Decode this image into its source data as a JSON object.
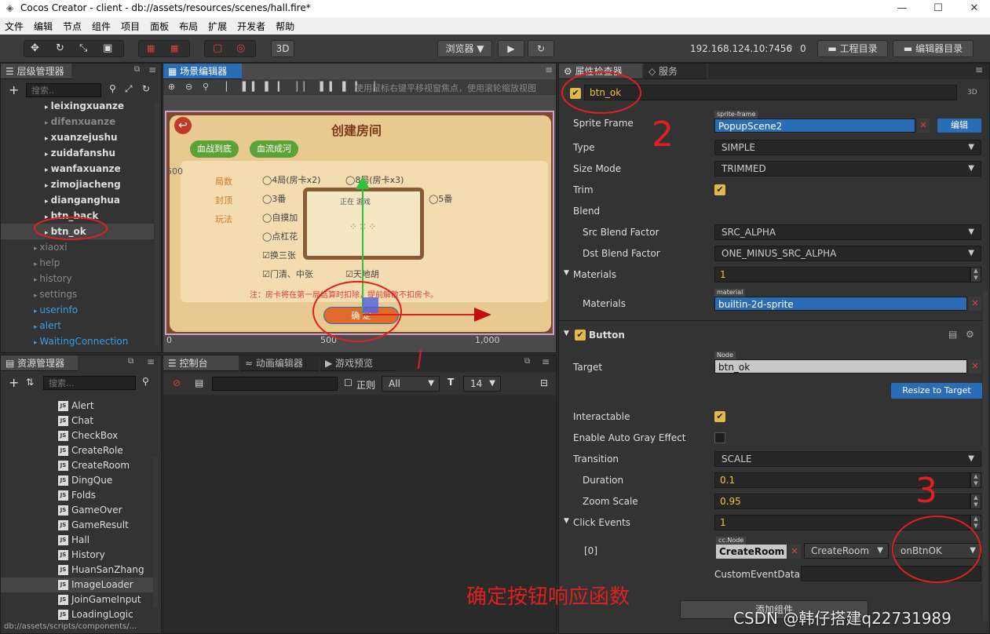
{
  "title": "Cocos Creator - client - db://assets/resources/scenes/hall.fire*",
  "window_controls": {
    "min": "—",
    "max": "☐",
    "close": "✕"
  },
  "menu": [
    "文件",
    "编辑",
    "节点",
    "组件",
    "项目",
    "面板",
    "布局",
    "扩展",
    "开发者",
    "帮助"
  ],
  "toolbar": {
    "mode_3d": "3D",
    "browser": "浏览器 ▼",
    "ip": "192.168.124.10:7456",
    "conn": "0",
    "project_dir": "工程目录",
    "editor_dir": "编辑器目录"
  },
  "hierarchy": {
    "tab": "层级管理器",
    "search_placeholder": "搜索..",
    "items": [
      {
        "label": "leixingxuanze",
        "style": "bold",
        "indent": 56
      },
      {
        "label": "difenxuanze",
        "style": "dimb",
        "indent": 56
      },
      {
        "label": "xuanzejushu",
        "style": "bold",
        "indent": 56
      },
      {
        "label": "zuidafanshu",
        "style": "bold",
        "indent": 56
      },
      {
        "label": "wanfaxuanze",
        "style": "bold",
        "indent": 56
      },
      {
        "label": "zimojiacheng",
        "style": "bold",
        "indent": 56
      },
      {
        "label": "dianganghua",
        "style": "bold",
        "indent": 56
      },
      {
        "label": "btn_back",
        "style": "bold",
        "indent": 56
      },
      {
        "label": "btn_ok",
        "style": "bold sel",
        "indent": 56
      },
      {
        "label": "xiaoxi",
        "style": "dim",
        "indent": 42
      },
      {
        "label": "help",
        "style": "dim",
        "indent": 42
      },
      {
        "label": "history",
        "style": "dim",
        "indent": 42
      },
      {
        "label": "settings",
        "style": "dim",
        "indent": 42
      },
      {
        "label": "userinfo",
        "style": "blue",
        "indent": 42
      },
      {
        "label": "alert",
        "style": "blue",
        "indent": 42
      },
      {
        "label": "WaitingConnection",
        "style": "blue",
        "indent": 42
      }
    ]
  },
  "scene": {
    "tab": "场景编辑器",
    "hint": "使用鼠标右键平移视窗焦点，使用滚轮缩放视图",
    "title": "创建房间",
    "tab1": "血战到底",
    "tab2": "血流成河",
    "ruler_left": "500",
    "ruler": [
      "0",
      "500",
      "1,000"
    ],
    "rows": [
      {
        "k": "局数",
        "a": "4局(房卡x2)",
        "b": "8局(房卡x3)"
      },
      {
        "k": "封顶",
        "a": "3番",
        "c": "5番"
      },
      {
        "k": "玩法",
        "a": "自摸加"
      },
      {
        "a": "点杠花"
      },
      {
        "a": "换三张"
      },
      {
        "a": "门清、中张",
        "b": "天地胡"
      }
    ],
    "popup": "正在   游戏",
    "note": "注：房卡将在第一局结算时扣除，提前解散不扣房卡。",
    "confirm": "确 定"
  },
  "assets": {
    "tab": "资源管理器",
    "search_placeholder": "搜索...",
    "scripts": [
      "Alert",
      "Chat",
      "CheckBox",
      "CreateRole",
      "CreateRoom",
      "DingQue",
      "Folds",
      "GameOver",
      "GameResult",
      "Hall",
      "History",
      "HuanSanZhang",
      "ImageLoader",
      "JoinGameInput",
      "LoadingLogic"
    ],
    "selected": "ImageLoader",
    "path": "db://assets/scripts/components/..."
  },
  "console": {
    "tab": "控制台",
    "tab2": "动画编辑器",
    "tab3": "游戏预览",
    "regex": "正则",
    "filter": "All",
    "font": "14"
  },
  "inspector": {
    "tab": "属性检查器",
    "tab2": "服务",
    "node_name": "btn_ok",
    "mode": "3D",
    "sprite_frame_label": "Sprite Frame",
    "sprite_frame_tag": "sprite-frame",
    "sprite_frame": "PopupScene2",
    "edit": "编辑",
    "type_label": "Type",
    "type": "SIMPLE",
    "size_mode_label": "Size Mode",
    "size_mode": "TRIMMED",
    "trim_label": "Trim",
    "blend_label": "Blend",
    "src_label": "Src Blend Factor",
    "src": "SRC_ALPHA",
    "dst_label": "Dst Blend Factor",
    "dst": "ONE_MINUS_SRC_ALPHA",
    "materials_label": "Materials",
    "materials_count": "1",
    "materials_item_label": "Materials",
    "material_tag": "material",
    "material": "builtin-2d-sprite",
    "button_label": "Button",
    "target_label": "Target",
    "node_tag": "Node",
    "target": "btn_ok",
    "resize": "Resize to Target",
    "interactable_label": "Interactable",
    "autogray_label": "Enable Auto Gray Effect",
    "transition_label": "Transition",
    "transition": "SCALE",
    "duration_label": "Duration",
    "duration": "0.1",
    "zoom_label": "Zoom Scale",
    "zoom": "0.95",
    "click_label": "Click Events",
    "click_count": "1",
    "idx": "[0]",
    "ccnode_tag": "cc.Node",
    "ev_node": "CreateRoom",
    "ev_comp": "CreateRoom",
    "ev_handler": "onBtnOK",
    "custom_label": "CustomEventData",
    "add_component": "添加组件"
  },
  "annotations": {
    "n2": "2",
    "n3": "3",
    "caption": "确定按钮响应函数",
    "watermark": "CSDN @韩仔搭建q22731989"
  }
}
